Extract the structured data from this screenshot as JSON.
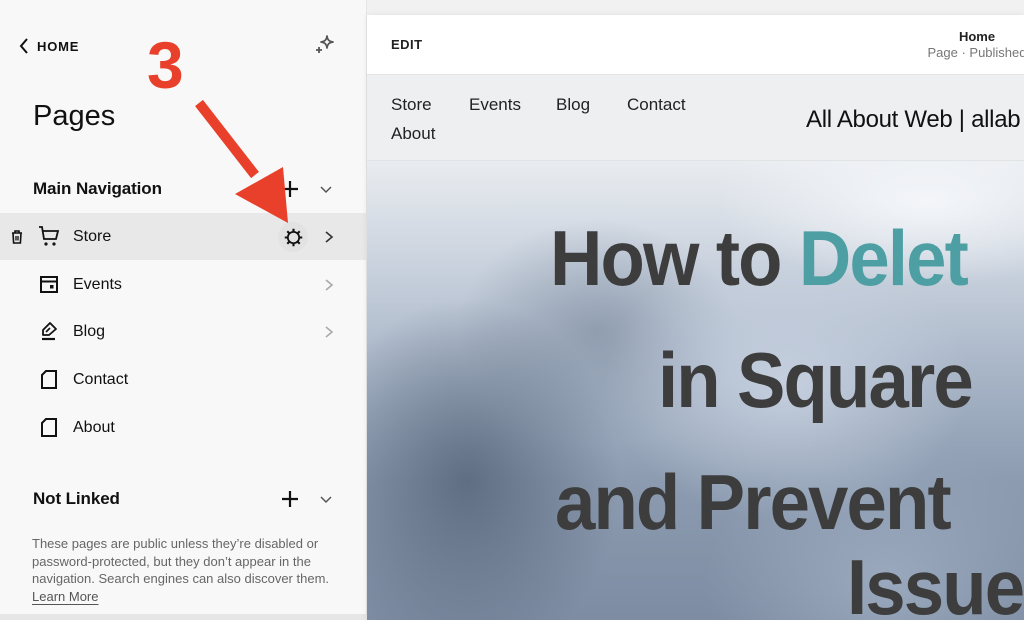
{
  "sidebar": {
    "back_label": "HOME",
    "title": "Pages",
    "main_navigation": {
      "label": "Main Navigation",
      "items": [
        {
          "label": "Store",
          "icon": "cart-icon",
          "active": true,
          "has_arrow": true
        },
        {
          "label": "Events",
          "icon": "calendar-icon",
          "active": false,
          "has_arrow": true
        },
        {
          "label": "Blog",
          "icon": "pen-icon",
          "active": false,
          "has_arrow": true
        },
        {
          "label": "Contact",
          "icon": "page-icon",
          "active": false,
          "has_arrow": false
        },
        {
          "label": "About",
          "icon": "page-icon",
          "active": false,
          "has_arrow": false
        }
      ]
    },
    "not_linked": {
      "label": "Not Linked",
      "description": "These pages are public unless they’re disabled or password-protected, but they don’t appear in the navigation. Search engines can also discover them.",
      "learn_more": "Learn More"
    }
  },
  "annotation": {
    "step_number": "3",
    "color": "#e8402a"
  },
  "preview": {
    "edit_label": "EDIT",
    "page_name": "Home",
    "page_status": "Page · Published",
    "site_nav": [
      "Store",
      "Events",
      "Blog",
      "Contact",
      "About"
    ],
    "site_title": "All About Web | allab",
    "hero": {
      "line1_prefix": "How to ",
      "line1_accent": "Delet",
      "line2": "in Square",
      "line3": "and Prevent",
      "line4": "Issue",
      "accent_color": "#4d9fa3"
    }
  }
}
